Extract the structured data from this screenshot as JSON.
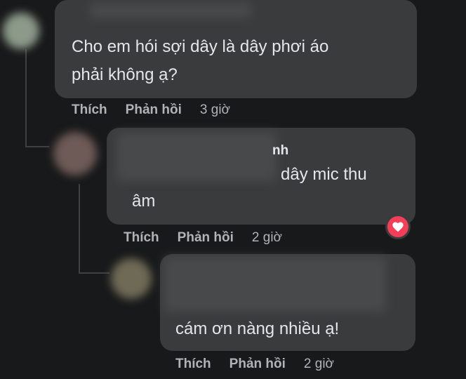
{
  "comments": [
    {
      "text_lines": [
        "Cho em hói sợi dây là dây phơi áo",
        "phải không ạ?"
      ],
      "actions": {
        "like": "Thích",
        "reply": "Phản hồi",
        "time": "3 giờ"
      }
    },
    {
      "name_fragment": "nh",
      "text_lines": [
        "dây mic thu",
        "âm"
      ],
      "reaction": "heart-icon",
      "actions": {
        "like": "Thích",
        "reply": "Phản hồi",
        "time": "2 giờ"
      }
    },
    {
      "text_lines": [
        "cám ơn nàng nhiều ạ!"
      ],
      "actions": {
        "like": "Thích",
        "reply": "Phản hồi",
        "time": "2 giờ"
      }
    }
  ],
  "colors": {
    "background": "#18191a",
    "bubble": "#3a3b3c",
    "text": "#e4e6eb",
    "secondary_text": "#b0b3b8",
    "reaction": "#f33e58"
  }
}
